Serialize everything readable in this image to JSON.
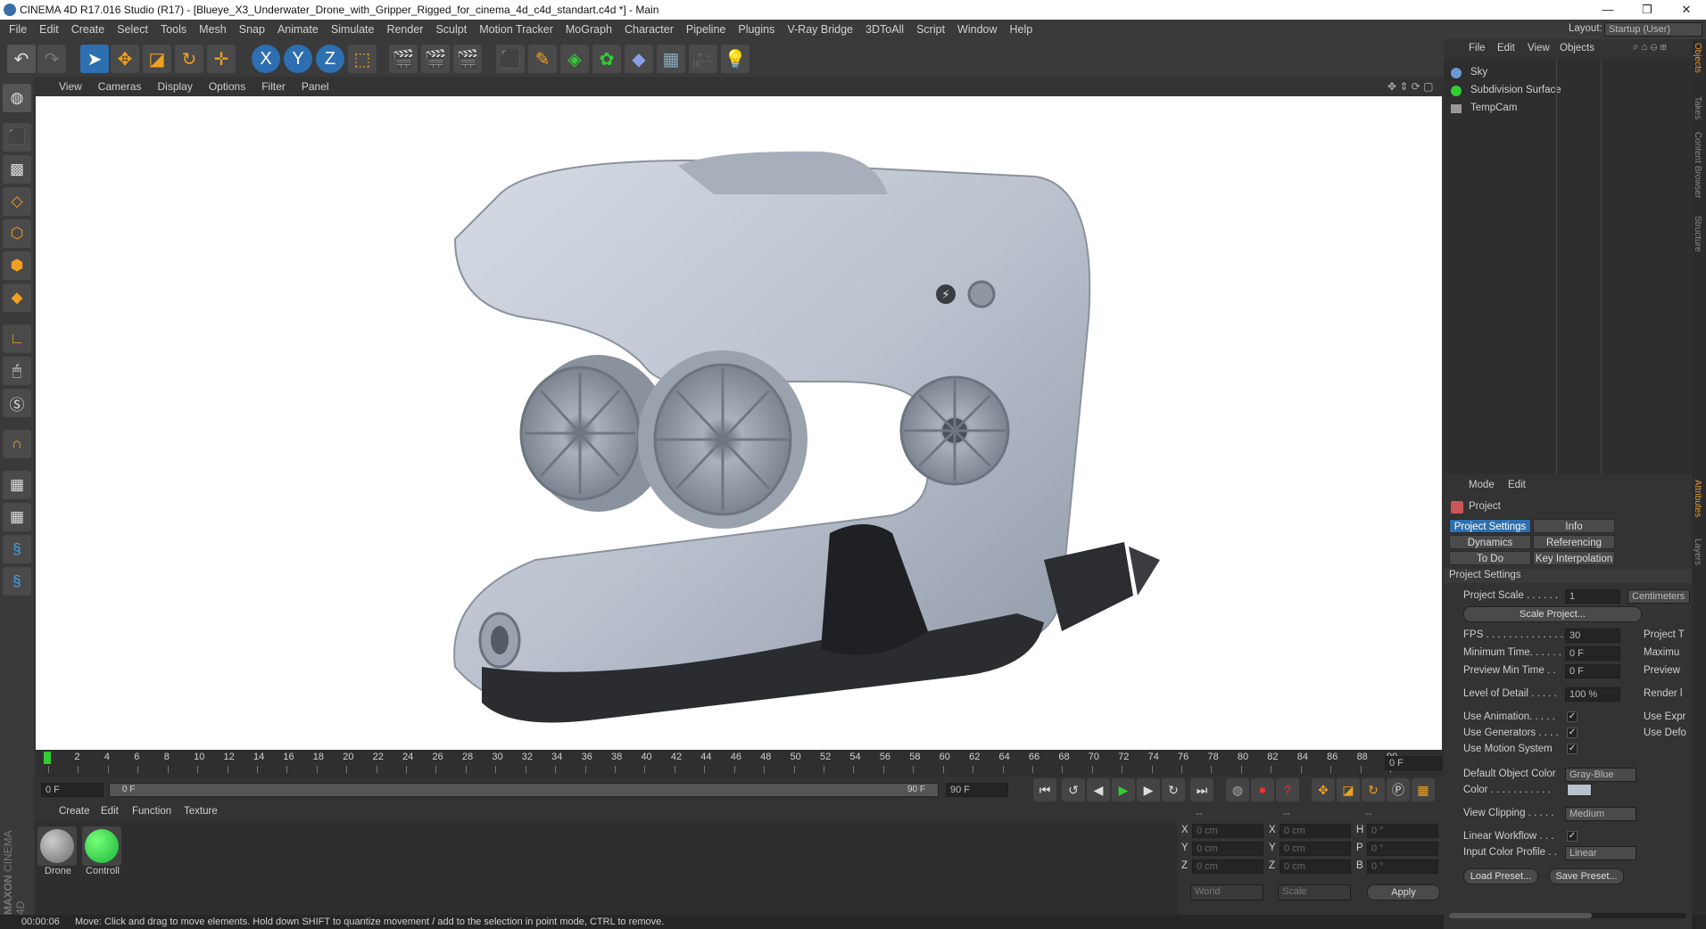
{
  "window": {
    "title": "CINEMA 4D R17.016 Studio (R17) - [Blueye_X3_Underwater_Drone_with_Gripper_Rigged_for_cinema_4d_c4d_standart.c4d *] - Main",
    "controls": [
      "—",
      "❐",
      "✕"
    ]
  },
  "menu": [
    "File",
    "Edit",
    "Create",
    "Select",
    "Tools",
    "Mesh",
    "Snap",
    "Animate",
    "Simulate",
    "Render",
    "Sculpt",
    "Motion Tracker",
    "MoGraph",
    "Character",
    "Pipeline",
    "Plugins",
    "V-Ray Bridge",
    "3DToAll",
    "Script",
    "Window",
    "Help"
  ],
  "layout": {
    "label": "Layout:",
    "value": "Startup (User)"
  },
  "viewport_menu": [
    "View",
    "Cameras",
    "Display",
    "Options",
    "Filter",
    "Panel"
  ],
  "timeline": {
    "ticks": [
      "0",
      "2",
      "4",
      "6",
      "8",
      "10",
      "12",
      "14",
      "16",
      "18",
      "20",
      "22",
      "24",
      "26",
      "28",
      "30",
      "32",
      "34",
      "36",
      "38",
      "40",
      "42",
      "44",
      "46",
      "48",
      "50",
      "52",
      "54",
      "56",
      "58",
      "60",
      "62",
      "64",
      "66",
      "68",
      "70",
      "72",
      "74",
      "76",
      "78",
      "80",
      "82",
      "84",
      "86",
      "88",
      "90"
    ],
    "current_frame": "0 F"
  },
  "transport": {
    "start_field": "0 F",
    "range_start": "0 F",
    "range_end": "90 F",
    "end_field": "90 F"
  },
  "material_manager": {
    "menu": [
      "Create",
      "Edit",
      "Function",
      "Texture"
    ],
    "materials": [
      {
        "name": "Drone",
        "color": "#6a6a6a"
      },
      {
        "name": "Controll",
        "color": "#18b43a"
      }
    ]
  },
  "coordinates": {
    "header": [
      "--",
      "--",
      "--"
    ],
    "rows": [
      {
        "a": "X",
        "av": "0 cm",
        "b": "X",
        "bv": "0 cm",
        "c": "H",
        "cv": "0 °"
      },
      {
        "a": "Y",
        "av": "0 cm",
        "b": "Y",
        "bv": "0 cm",
        "c": "P",
        "cv": "0 °"
      },
      {
        "a": "Z",
        "av": "0 cm",
        "b": "Z",
        "bv": "0 cm",
        "c": "B",
        "cv": "0 °"
      }
    ],
    "mode1": "World",
    "mode2": "Scale",
    "apply": "Apply"
  },
  "status": {
    "time": "00:00:06",
    "message": "Move: Click and drag to move elements. Hold down SHIFT to quantize movement / add to the selection in point mode, CTRL to remove."
  },
  "object_manager": {
    "menu": [
      "File",
      "Edit",
      "View",
      "Objects"
    ],
    "objects": [
      "Sky",
      "Subdivision Surface",
      "TempCam"
    ]
  },
  "attributes": {
    "menu": [
      "Mode",
      "Edit"
    ],
    "object": "Project",
    "tabs": [
      "Project Settings",
      "Info",
      "Dynamics",
      "Referencing",
      "To Do",
      "Key Interpolation"
    ],
    "section": "Project Settings",
    "project_scale_label": "Project Scale . . . . . .",
    "project_scale_value": "1",
    "project_scale_unit": "Centimeters",
    "scale_project_btn": "Scale Project...",
    "fps_label": "FPS . . . . . . . . . . . . . .",
    "fps_value": "30",
    "fps_right": "Project T",
    "min_time_label": "Minimum Time. . . . . .",
    "min_time_value": "0 F",
    "min_time_right": "Maximu",
    "preview_min_label": "Preview Min Time . .",
    "preview_min_value": "0 F",
    "preview_min_right": "Preview",
    "lod_label": "Level of Detail . . . . .",
    "lod_value": "100 %",
    "lod_right": "Render l",
    "use_anim_label": "Use Animation. . . . .",
    "use_anim_right": "Use Expr",
    "use_gen_label": "Use Generators . . . .",
    "use_gen_right": "Use Defo",
    "use_motion_label": "Use Motion System",
    "def_color_label": "Default Object Color",
    "def_color_value": "Gray-Blue",
    "color_label": "Color . . . . . . . . . . .",
    "view_clip_label": "View Clipping . . . . .",
    "view_clip_value": "Medium",
    "linear_wf_label": "Linear Workflow . . .",
    "input_cp_label": "Input Color Profile . .",
    "input_cp_value": "Linear",
    "load_preset": "Load Preset...",
    "save_preset": "Save Preset..."
  },
  "side_tabs": [
    "Objects",
    "Takes",
    "Content Browser",
    "Structure",
    "Attributes",
    "Layers"
  ],
  "brand": {
    "line1": "MAXON",
    "line2": "CINEMA 4D"
  },
  "drone_color": "#b8c0cc"
}
